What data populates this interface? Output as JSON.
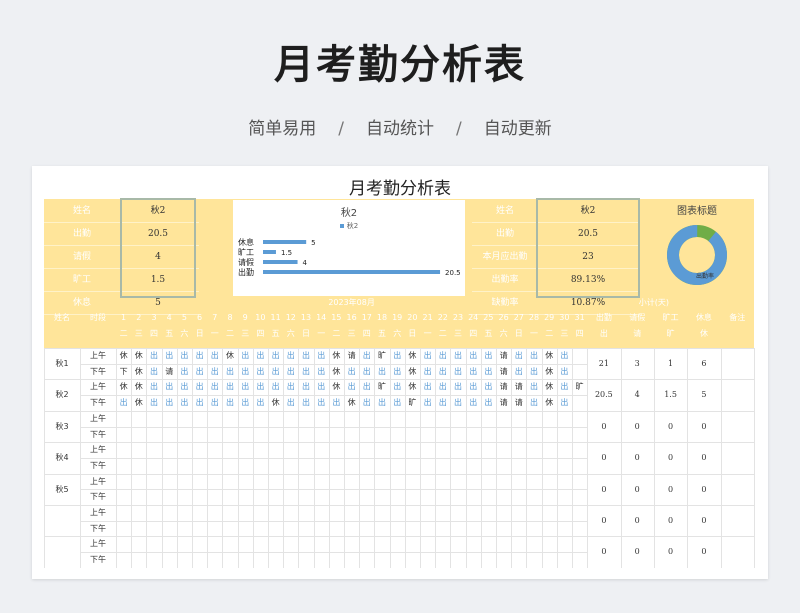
{
  "page": {
    "title": "月考勤分析表",
    "tags": [
      "简单易用",
      "自动统计",
      "自动更新"
    ],
    "separator": "/"
  },
  "sheet": {
    "title": "月考勤分析表",
    "left_panel": {
      "rows": [
        {
          "label": "姓名",
          "value": "秋2"
        },
        {
          "label": "出勤",
          "value": "20.5"
        },
        {
          "label": "请假",
          "value": "4"
        },
        {
          "label": "旷工",
          "value": "1.5"
        },
        {
          "label": "休息",
          "value": "5"
        }
      ]
    },
    "right_panel": {
      "rows": [
        {
          "label": "姓名",
          "value": "秋2"
        },
        {
          "label": "出勤",
          "value": "20.5"
        },
        {
          "label": "本月应出勤",
          "value": "23"
        },
        {
          "label": "出勤率",
          "value": "89.13%"
        },
        {
          "label": "缺勤率",
          "value": "10.87%"
        }
      ]
    },
    "donut": {
      "title": "图表标题",
      "label": "出勤率",
      "attendance_rate": 0.8913,
      "colors": {
        "main": "#5b9bd5",
        "rest": "#70ad47",
        "hole": "#ffffff"
      }
    },
    "grid": {
      "month": "2023年08月",
      "summary_title": "小计(天)",
      "col_name": "姓名",
      "col_period": "时段",
      "days": [
        "1",
        "2",
        "3",
        "4",
        "5",
        "6",
        "7",
        "8",
        "9",
        "10",
        "11",
        "12",
        "13",
        "14",
        "15",
        "16",
        "17",
        "18",
        "19",
        "20",
        "21",
        "22",
        "23",
        "24",
        "25",
        "26",
        "27",
        "28",
        "29",
        "30",
        "31"
      ],
      "weekdays": [
        "二",
        "三",
        "四",
        "五",
        "六",
        "日",
        "一",
        "二",
        "三",
        "四",
        "五",
        "六",
        "日",
        "一",
        "二",
        "三",
        "四",
        "五",
        "六",
        "日",
        "一",
        "二",
        "三",
        "四",
        "五",
        "六",
        "日",
        "一",
        "二",
        "三",
        "四"
      ],
      "summary_cols": [
        {
          "h1": "出勤",
          "h2": "出"
        },
        {
          "h1": "请假",
          "h2": "请"
        },
        {
          "h1": "旷工",
          "h2": "旷"
        },
        {
          "h1": "休息",
          "h2": "休"
        },
        {
          "h1": "备注",
          "h2": ""
        }
      ],
      "am": "上午",
      "pm": "下午",
      "employees": [
        {
          "name": "秋1",
          "am": [
            "休",
            "休",
            "出",
            "出",
            "出",
            "出",
            "出",
            "休",
            "出",
            "出",
            "出",
            "出",
            "出",
            "出",
            "休",
            "请",
            "出",
            "旷",
            "出",
            "休",
            "出",
            "出",
            "出",
            "出",
            "出",
            "请",
            "出",
            "出",
            "休",
            "出",
            ""
          ],
          "pm": [
            "下",
            "休",
            "出",
            "请",
            "出",
            "出",
            "出",
            "出",
            "出",
            "出",
            "出",
            "出",
            "出",
            "出",
            "休",
            "出",
            "出",
            "出",
            "出",
            "休",
            "出",
            "出",
            "出",
            "出",
            "出",
            "请",
            "出",
            "出",
            "休",
            "出",
            ""
          ],
          "stats": [
            "21",
            "3",
            "1",
            "6",
            ""
          ]
        },
        {
          "name": "秋2",
          "am": [
            "休",
            "休",
            "出",
            "出",
            "出",
            "出",
            "出",
            "出",
            "出",
            "出",
            "出",
            "出",
            "出",
            "出",
            "休",
            "出",
            "出",
            "旷",
            "出",
            "休",
            "出",
            "出",
            "出",
            "出",
            "出",
            "请",
            "请",
            "出",
            "休",
            "出",
            "旷"
          ],
          "pm": [
            "出",
            "休",
            "出",
            "出",
            "出",
            "出",
            "出",
            "出",
            "出",
            "出",
            "休",
            "出",
            "出",
            "出",
            "出",
            "休",
            "出",
            "出",
            "出",
            "旷",
            "出",
            "出",
            "出",
            "出",
            "出",
            "请",
            "请",
            "出",
            "休",
            "出",
            ""
          ],
          "stats": [
            "20.5",
            "4",
            "1.5",
            "5",
            ""
          ]
        },
        {
          "name": "秋3",
          "am": [],
          "pm": [],
          "stats": [
            "0",
            "0",
            "0",
            "0",
            ""
          ]
        },
        {
          "name": "秋4",
          "am": [],
          "pm": [],
          "stats": [
            "0",
            "0",
            "0",
            "0",
            ""
          ]
        },
        {
          "name": "秋5",
          "am": [],
          "pm": [],
          "stats": [
            "0",
            "0",
            "0",
            "0",
            ""
          ]
        },
        {
          "name": "",
          "am": [],
          "pm": [],
          "stats": [
            "0",
            "0",
            "0",
            "0",
            ""
          ]
        },
        {
          "name": "",
          "am": [],
          "pm": [],
          "stats": [
            "0",
            "0",
            "0",
            "0",
            ""
          ]
        }
      ]
    }
  },
  "chart_data": {
    "type": "bar",
    "title": "秋2",
    "legend": "秋2",
    "categories": [
      "休息",
      "旷工",
      "请假",
      "出勤"
    ],
    "values": [
      5,
      1.5,
      4,
      20.5
    ],
    "color": "#5b9bd5",
    "xlim": [
      0,
      22
    ]
  }
}
